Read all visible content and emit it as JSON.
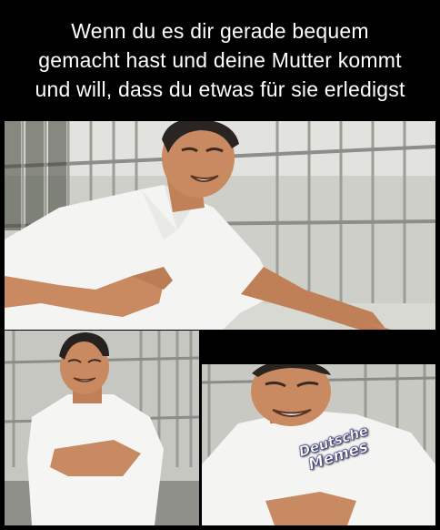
{
  "caption": {
    "line1": "Wenn du es dir gerade bequem",
    "line2": "gemacht hast und deine Mutter kommt",
    "line3": "und will, dass du etwas für sie erledigst"
  },
  "watermark": {
    "line1": "Deutsche",
    "line2": "Memes"
  },
  "panels": [
    {
      "id": "top",
      "description": "man in white shirt clutching chest, grimacing"
    },
    {
      "id": "bottom-left",
      "description": "man clutching chest with both hands"
    },
    {
      "id": "bottom-right",
      "description": "close-up of man grimacing holding chest"
    }
  ],
  "colors": {
    "background": "#000000",
    "caption_text": "#ffffff",
    "shirt": "#f3f3f1",
    "skin": "#c98a62",
    "hair": "#2a2522",
    "wall": "#c9c9c4"
  }
}
